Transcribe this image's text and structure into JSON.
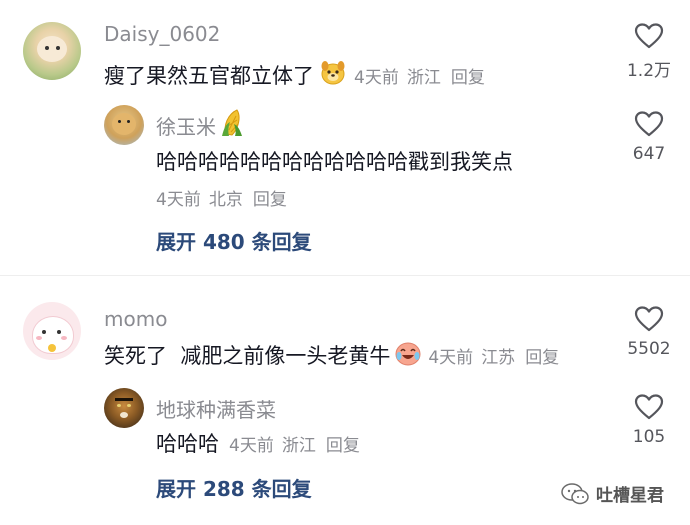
{
  "comments": [
    {
      "username": "Daisy_0602",
      "text": "瘦了果然五官都立体了",
      "time": "4天前",
      "location": "浙江",
      "reply": "回复",
      "likes": "1.2万",
      "replies": [
        {
          "username": "徐玉米",
          "text": "哈哈哈哈哈哈哈哈哈哈哈哈戳到我笑点",
          "time": "4天前",
          "location": "北京",
          "reply": "回复",
          "likes": "647"
        }
      ],
      "expand_label": "展开 480 条回复"
    },
    {
      "username": "momo",
      "text": "笑死了  减肥之前像一头老黄牛",
      "time": "4天前",
      "location": "江苏",
      "reply": "回复",
      "likes": "5502",
      "replies": [
        {
          "username": "地球种满香菜",
          "text": "哈哈哈",
          "time": "4天前",
          "location": "浙江",
          "reply": "回复",
          "likes": "105"
        }
      ],
      "expand_label": "展开 288 条回复"
    }
  ],
  "watermark": {
    "text": "吐槽星君"
  },
  "icons": {
    "like": "heart-outline-icon",
    "dog_emoji": "dog-face-emoji",
    "corn_emoji": "corn-emoji",
    "cry_emoji": "crying-laugh-emoji"
  }
}
